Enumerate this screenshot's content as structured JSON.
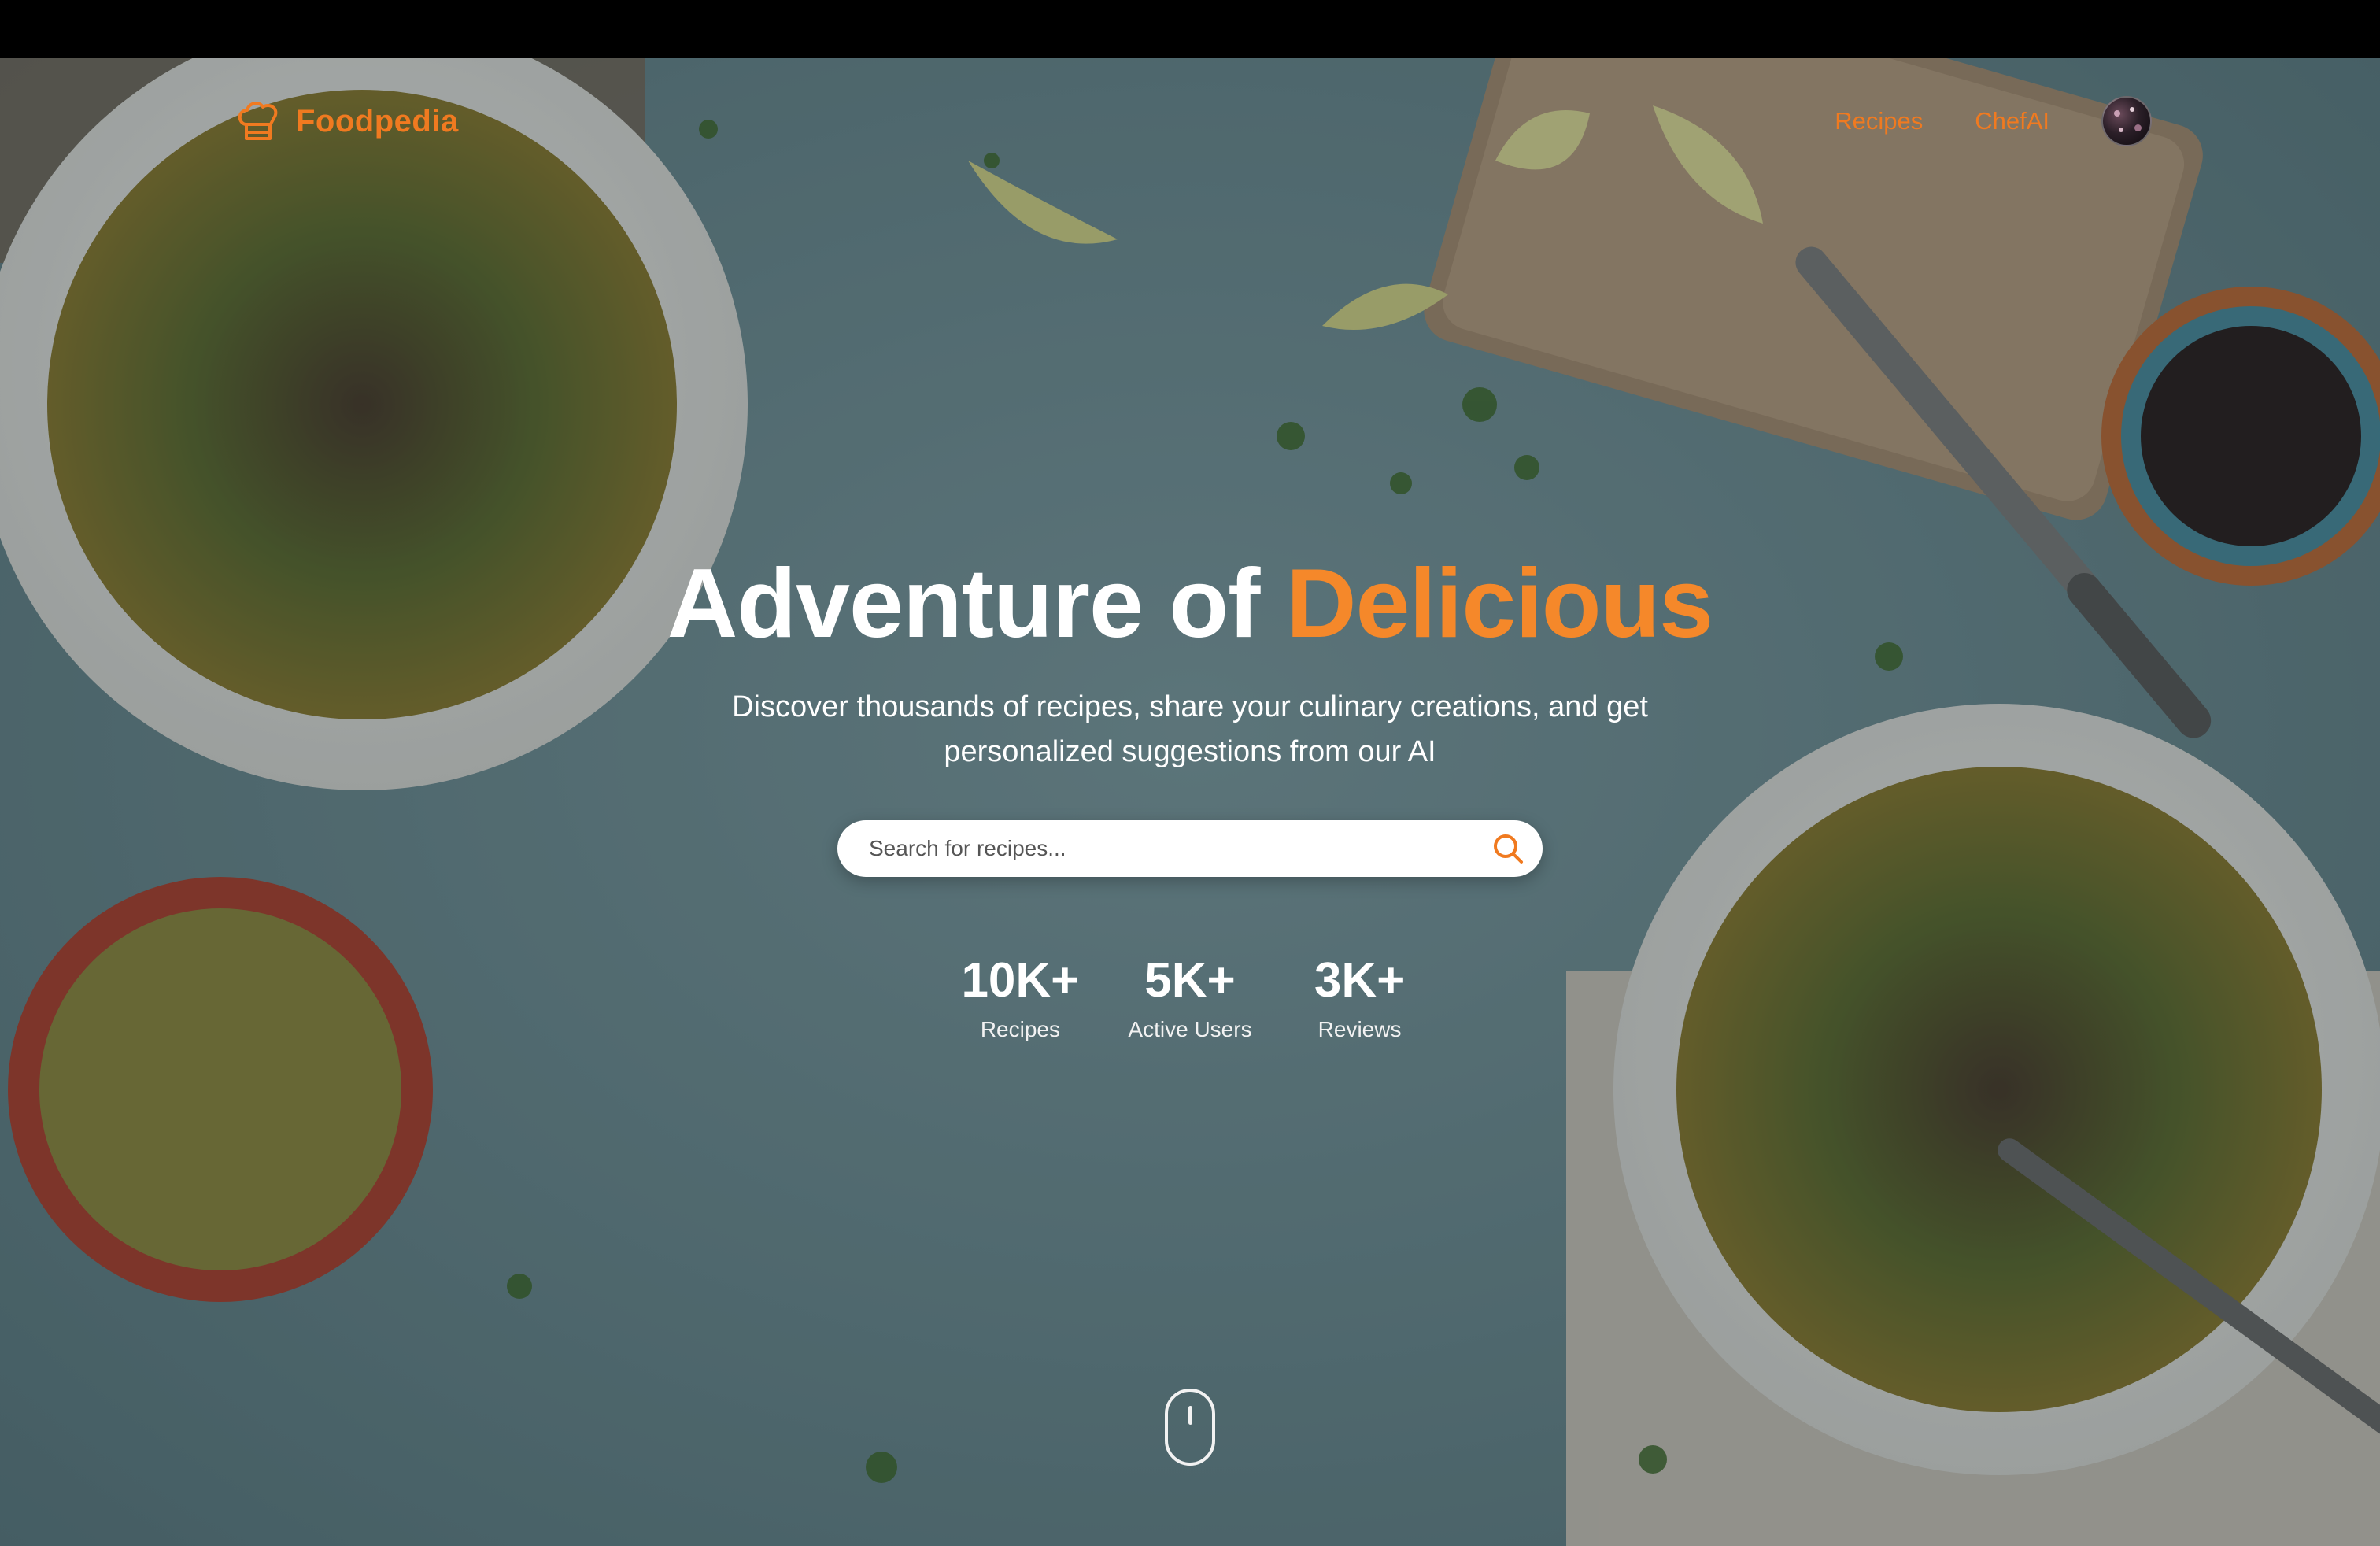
{
  "brand": {
    "name": "Foodpedia",
    "icon": "chef-hat-icon",
    "color": "#f07a20"
  },
  "nav": {
    "links": [
      {
        "label": "Recipes"
      },
      {
        "label": "ChefAI"
      }
    ],
    "avatar": "user-avatar"
  },
  "hero": {
    "title_main": "Adventure of ",
    "title_accent": "Delicious",
    "accent_color": "#f5882a",
    "subtitle": "Discover thousands of recipes, share your culinary creations, and get personalized suggestions from our AI"
  },
  "search": {
    "placeholder": "Search for recipes...",
    "icon": "search-icon"
  },
  "stats": [
    {
      "value": "10K+",
      "label": "Recipes"
    },
    {
      "value": "5K+",
      "label": "Active Users"
    },
    {
      "value": "3K+",
      "label": "Reviews"
    }
  ],
  "scroll_indicator": {
    "icon": "mouse-scroll-icon"
  }
}
